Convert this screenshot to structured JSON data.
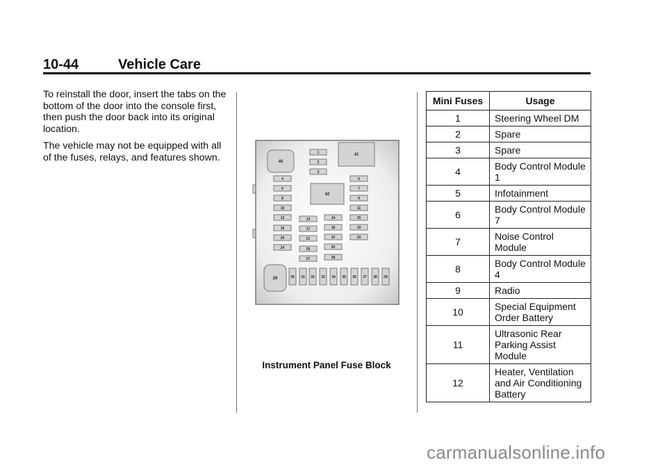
{
  "header": {
    "page_number": "10-44",
    "section_title": "Vehicle Care"
  },
  "body_text": {
    "paragraphs": [
      "To reinstall the door, insert the tabs on the bottom of the door into the console first, then push the door back into its original location.",
      "The vehicle may not be equipped with all of the fuses, relays, and features shown."
    ]
  },
  "figure": {
    "caption": "Instrument Panel Fuse Block",
    "fuse_labels": {
      "relay_40": "40",
      "relay_41": "41",
      "relay_42": "42",
      "relay_29": "29",
      "f1": "1",
      "f2": "2",
      "f3": "3",
      "f4": "4",
      "f5": "5",
      "f6": "6",
      "f7": "7",
      "f8": "8",
      "f9": "9",
      "f10": "10",
      "f11": "11",
      "f12": "12",
      "f13": "13",
      "f14": "14",
      "f15": "15",
      "f16": "16",
      "f17": "17",
      "f18": "18",
      "f19": "19",
      "f20": "20",
      "f21": "21",
      "f22": "22",
      "f23": "23",
      "f24": "24",
      "f25": "25",
      "f26": "26",
      "f27": "27",
      "f28": "28",
      "f30": "30",
      "f31": "31",
      "f32": "32",
      "f33": "33",
      "f34": "34",
      "f35": "35",
      "f36": "36",
      "f37": "37",
      "f38": "38",
      "f39": "39"
    }
  },
  "fuse_table": {
    "headers": [
      "Mini Fuses",
      "Usage"
    ],
    "rows": [
      {
        "fuse": "1",
        "usage": "Steering Wheel DM"
      },
      {
        "fuse": "2",
        "usage": "Spare"
      },
      {
        "fuse": "3",
        "usage": "Spare"
      },
      {
        "fuse": "4",
        "usage": "Body Control Module 1"
      },
      {
        "fuse": "5",
        "usage": "Infotainment"
      },
      {
        "fuse": "6",
        "usage": "Body Control Module 7"
      },
      {
        "fuse": "7",
        "usage": "Noise Control Module"
      },
      {
        "fuse": "8",
        "usage": "Body Control Module 4"
      },
      {
        "fuse": "9",
        "usage": "Radio"
      },
      {
        "fuse": "10",
        "usage": "Special Equipment Order Battery"
      },
      {
        "fuse": "11",
        "usage": "Ultrasonic Rear Parking Assist Module"
      },
      {
        "fuse": "12",
        "usage": "Heater, Ventilation and Air Conditioning Battery"
      }
    ]
  },
  "watermark": "carmanualsonline.info"
}
